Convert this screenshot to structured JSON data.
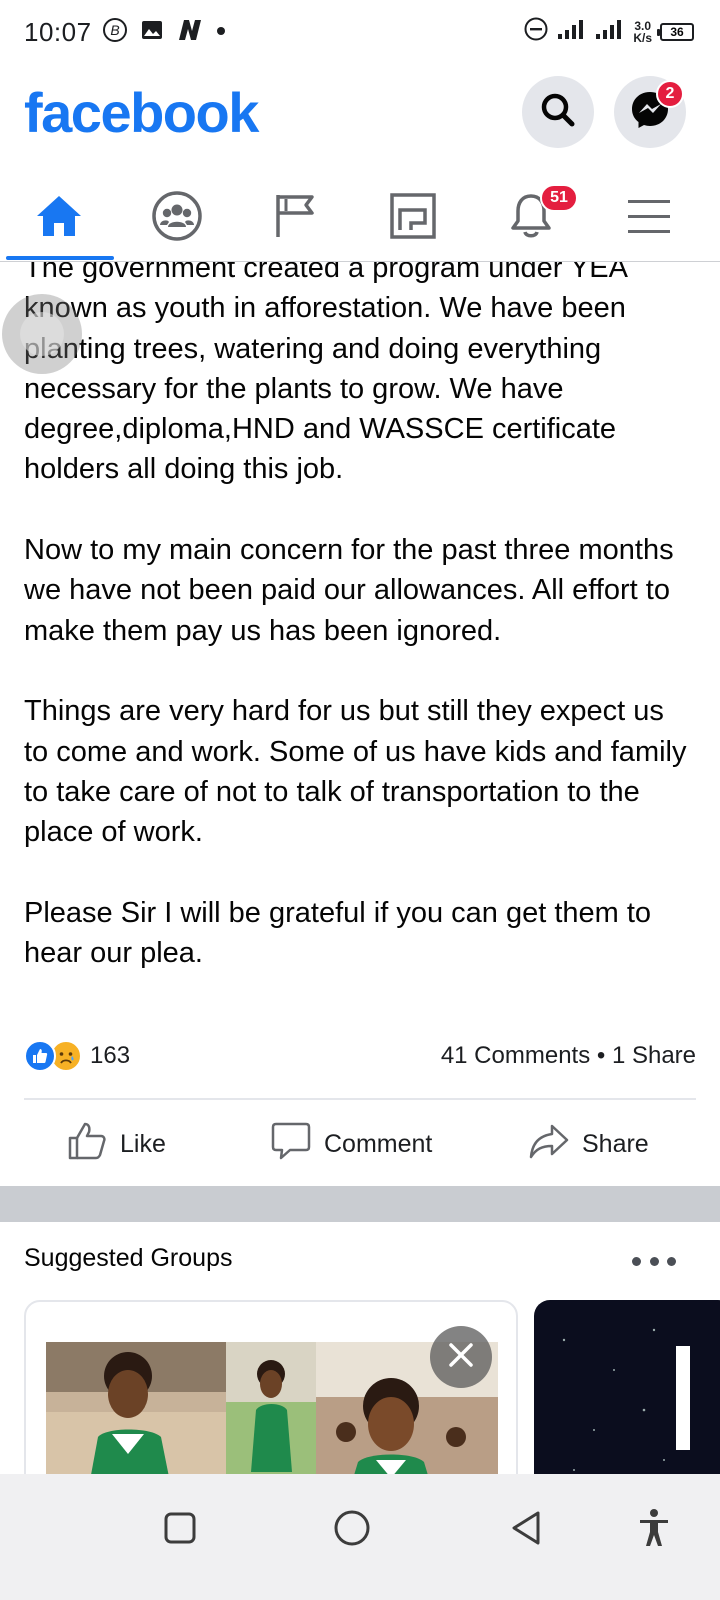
{
  "status_bar": {
    "time": "10:07",
    "speed_value": "3.0",
    "speed_unit": "K/s",
    "battery": "36"
  },
  "header": {
    "logo": "facebook",
    "messenger_badge": "2"
  },
  "tabs": {
    "items": [
      "home",
      "groups",
      "pages",
      "marketplace",
      "notifications",
      "menu"
    ],
    "active": "home",
    "notifications_badge": "51"
  },
  "post": {
    "paragraphs": [
      "The government created a program under YEA known as youth in afforestation. We have been planting trees, watering and doing everything necessary for the plants to grow. We have degree,diploma,HND and WASSCE certificate holders all doing this job.",
      "Now to my main concern for the past three months we have not been paid our allowances. All effort to make them pay us has been ignored.",
      "Things are very hard for us but still they expect us to come and work. Some of us have kids and family to take care of not to talk of transportation to the place of work.",
      "Please Sir I will be grateful if you can get them to hear our plea."
    ],
    "reaction_count": "163",
    "engagement": "41 Comments • 1 Share",
    "actions": {
      "like": "Like",
      "comment": "Comment",
      "share": "Share"
    }
  },
  "suggested_groups": {
    "title": "Suggested Groups"
  },
  "colors": {
    "brand": "#1877f2",
    "badge": "#e41e3f",
    "separator": "#c9ccd1"
  }
}
